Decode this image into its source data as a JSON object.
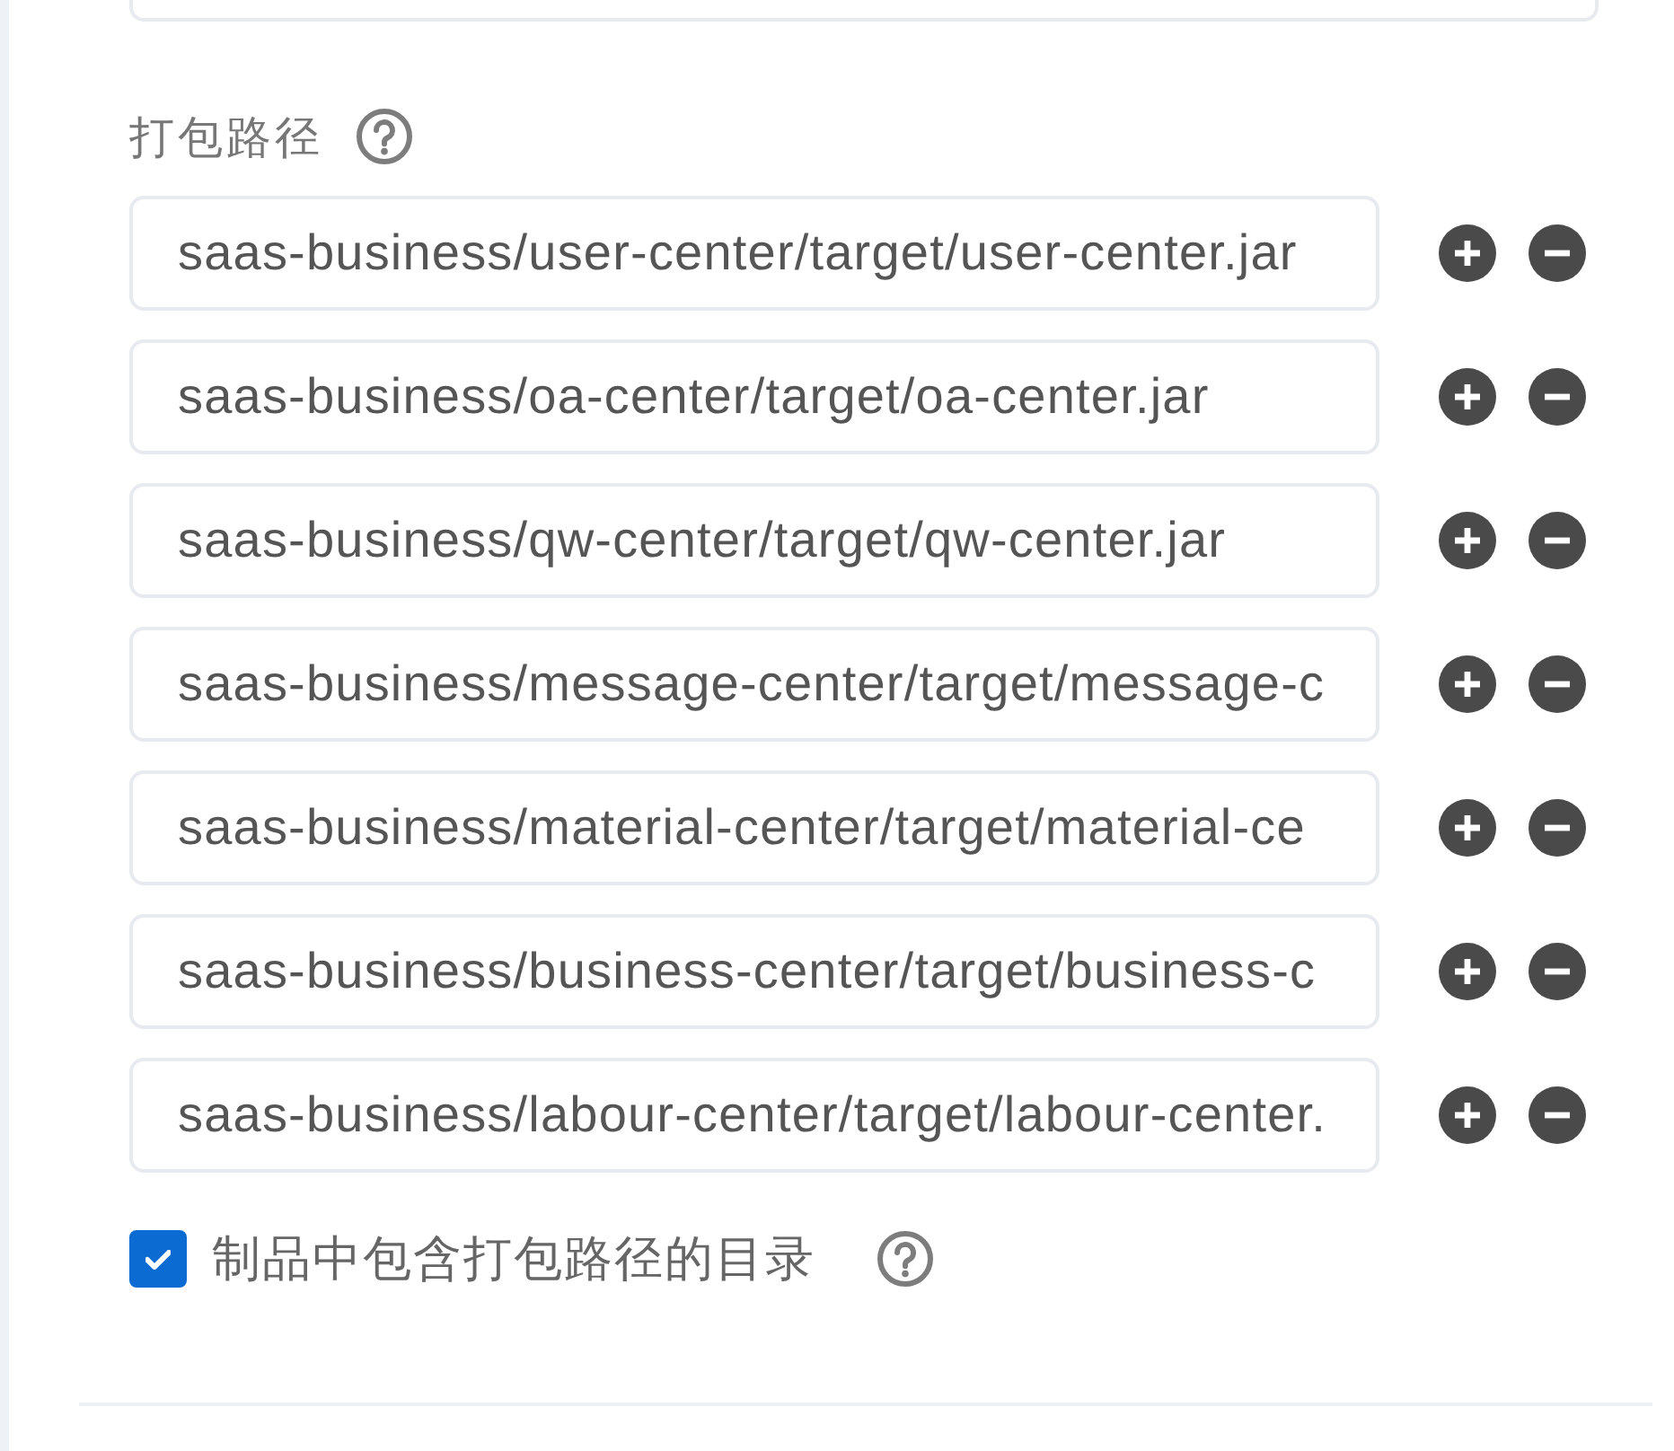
{
  "package_paths": {
    "label": "打包路径",
    "paths": [
      {
        "value": "saas-business/user-center/target/user-center.jar"
      },
      {
        "value": "saas-business/oa-center/target/oa-center.jar"
      },
      {
        "value": "saas-business/qw-center/target/qw-center.jar"
      },
      {
        "value": "saas-business/message-center/target/message-c"
      },
      {
        "value": "saas-business/material-center/target/material-ce"
      },
      {
        "value": "saas-business/business-center/target/business-c"
      },
      {
        "value": "saas-business/labour-center/target/labour-center."
      }
    ]
  },
  "include_dir": {
    "label": "制品中包含打包路径的目录",
    "checked": true
  }
}
